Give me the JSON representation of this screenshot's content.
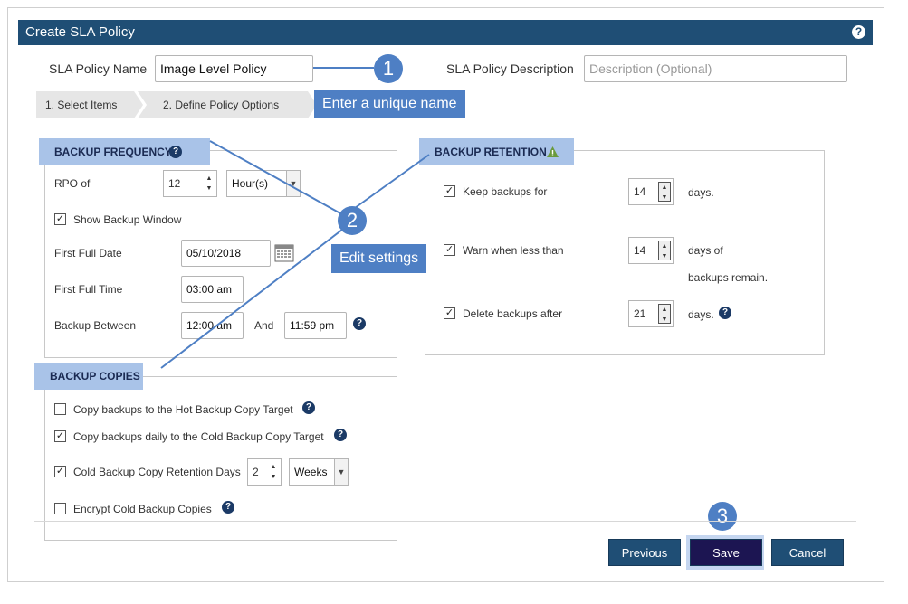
{
  "dialog": {
    "title": "Create SLA Policy",
    "help": "?"
  },
  "header": {
    "policy_name_label": "SLA Policy Name",
    "policy_name_value": "Image Level Policy",
    "description_label": "SLA Policy Description",
    "description_placeholder": "Description (Optional)"
  },
  "steps": [
    "1. Select Items",
    "2. Define Policy Options"
  ],
  "callouts": {
    "one": "1",
    "two": "2",
    "three": "3",
    "enter_name": "Enter a unique name",
    "edit_settings": "Edit settings"
  },
  "backup_frequency": {
    "title": "BACKUP FREQUENCY",
    "rpo_label": "RPO of",
    "rpo_value": "12",
    "rpo_unit": "Hour(s)",
    "show_window_label": "Show Backup Window",
    "show_window_checked": true,
    "first_full_date_label": "First Full Date",
    "first_full_date_value": "05/10/2018",
    "first_full_time_label": "First Full Time",
    "first_full_time_value": "03:00 am",
    "backup_between_label": "Backup Between",
    "backup_between_start": "12:00 am",
    "and_label": "And",
    "backup_between_end": "11:59 pm"
  },
  "backup_copies": {
    "title": "BACKUP COPIES",
    "hot_label": "Copy backups to the Hot Backup Copy Target",
    "hot_checked": false,
    "cold_label": "Copy backups daily to the Cold Backup Copy Target",
    "cold_checked": true,
    "retention_label": "Cold Backup Copy Retention Days",
    "retention_checked": true,
    "retention_value": "2",
    "retention_unit": "Weeks",
    "encrypt_label": "Encrypt Cold Backup Copies",
    "encrypt_checked": false
  },
  "backup_retention": {
    "title": "BACKUP RETENTION",
    "keep_label": "Keep backups for",
    "keep_value": "14",
    "keep_unit": "days.",
    "warn_label": "Warn when less than",
    "warn_value": "14",
    "warn_unit_line1": "days of",
    "warn_unit_line2": "backups remain.",
    "delete_label": "Delete backups after",
    "delete_value": "21",
    "delete_unit": "days."
  },
  "buttons": {
    "previous": "Previous",
    "save": "Save",
    "cancel": "Cancel"
  },
  "colors": {
    "titlebar": "#1f4e75",
    "callout": "#4e7fc4",
    "panel_title": "#a9c3e8",
    "save_button": "#1c1552"
  }
}
